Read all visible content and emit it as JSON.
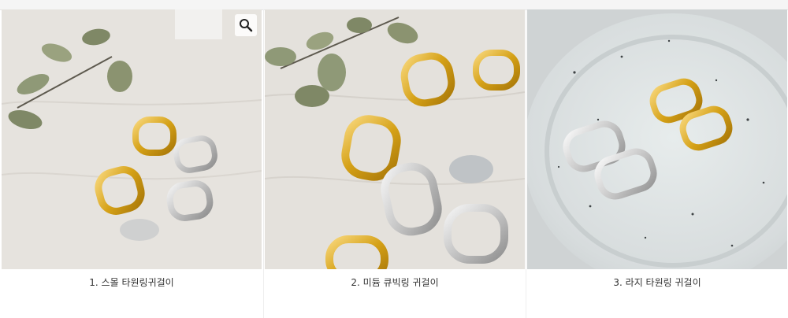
{
  "gallery": {
    "items": [
      {
        "caption": "1. 스몰 타원링귀걸이",
        "icon": "zoom-icon"
      },
      {
        "caption": "2. 미듐  큐빅링 귀걸이"
      },
      {
        "caption": "3. 라지 타원링 귀걸이"
      }
    ]
  },
  "colors": {
    "gold": "#d5a117",
    "silver": "#c9c9c9",
    "leaf": "#8f9977",
    "table": "#e6e3de",
    "dish": "#d7dcdd"
  }
}
